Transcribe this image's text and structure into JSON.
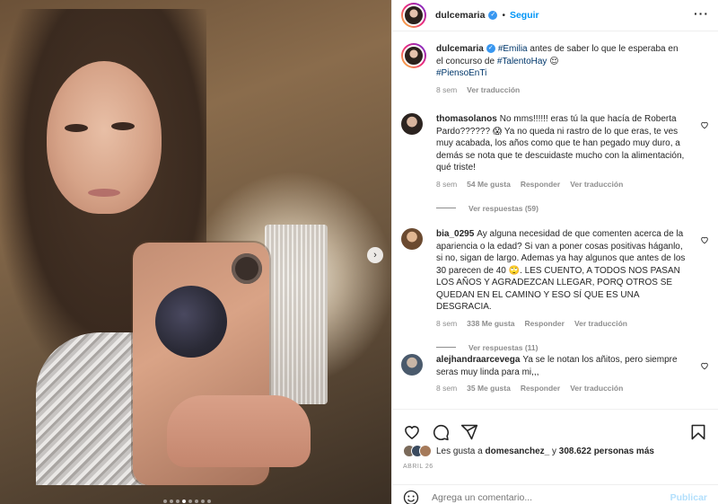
{
  "post": {
    "username": "dulcemaria",
    "follow_label": "Seguir",
    "separator": "•",
    "more_icon": "more-horizontal-icon"
  },
  "caption": {
    "username": "dulcemaria",
    "text_part1": "#Emilia",
    "text_part2": " antes de saber lo que le esperaba en el concurso de ",
    "text_part3": "#TalentoHay",
    "text_part4": " 😌",
    "hashtag_line2": "#PiensoEnTi",
    "time": "8 sem",
    "translate": "Ver traducción"
  },
  "comments": [
    {
      "username": "thomasolanos",
      "text": "No mms!!!!!! eras tú la que hacía de Roberta Pardo?????? 😱 Ya no queda ni rastro de lo que eras, te ves muy acabada, los años como que te han pegado muy duro, a demás se nota que te descuidaste mucho con la alimentación, qué triste!",
      "time": "8 sem",
      "likes": "54 Me gusta",
      "reply": "Responder",
      "translate": "Ver traducción",
      "replies": "Ver respuestas (59)"
    },
    {
      "username": "bia_0295",
      "text": "Ay alguna necesidad de que comenten acerca de la apariencia o la edad? Si van a poner cosas positivas háganlo, si no, sigan de largo. Ademas ya hay algunos que antes de los 30 parecen de 40 🙄. LES CUENTO, A TODOS NOS PASAN LOS AÑOS Y AGRADEZCAN LLEGAR, PORQ OTROS SE QUEDAN EN EL CAMINO Y ESO SÍ QUE ES UNA DESGRACIA.",
      "time": "8 sem",
      "likes": "338 Me gusta",
      "reply": "Responder",
      "translate": "Ver traducción",
      "replies": "Ver respuestas (11)"
    },
    {
      "username": "alejhandraarcevega",
      "text": "Ya se le notan los añitos, pero siempre seras muy linda para mi,,,",
      "time": "8 sem",
      "likes": "35 Me gusta",
      "reply": "Responder",
      "translate": "Ver traducción"
    }
  ],
  "likes": {
    "prefix": "Les gusta a",
    "user": "domesanchez_",
    "middle": "y",
    "count": "308.622 personas más"
  },
  "date": "ABRIL 26",
  "comment_box": {
    "placeholder": "Agrega un comentario...",
    "post_label": "Publicar"
  },
  "carousel": {
    "slide_count": 8,
    "active_index": 3
  },
  "colors": {
    "accent": "#0095f6",
    "verified": "#3897f0",
    "muted": "#8e8e8e",
    "post_disabled": "#b2dffc"
  }
}
